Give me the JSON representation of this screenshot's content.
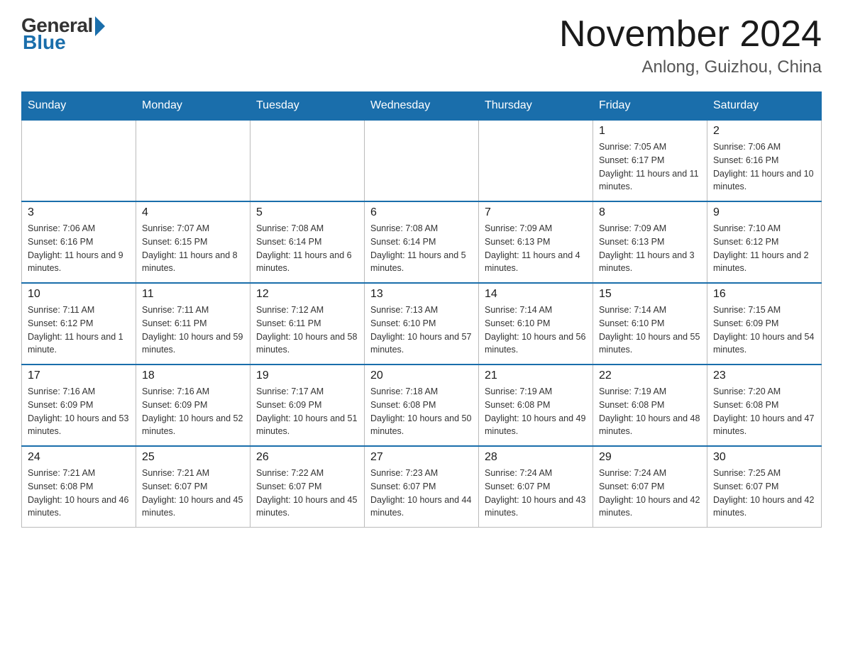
{
  "header": {
    "logo": {
      "general": "General",
      "blue": "Blue"
    },
    "title": "November 2024",
    "location": "Anlong, Guizhou, China"
  },
  "days_of_week": [
    "Sunday",
    "Monday",
    "Tuesday",
    "Wednesday",
    "Thursday",
    "Friday",
    "Saturday"
  ],
  "weeks": [
    {
      "days": [
        {
          "number": "",
          "info": ""
        },
        {
          "number": "",
          "info": ""
        },
        {
          "number": "",
          "info": ""
        },
        {
          "number": "",
          "info": ""
        },
        {
          "number": "",
          "info": ""
        },
        {
          "number": "1",
          "info": "Sunrise: 7:05 AM\nSunset: 6:17 PM\nDaylight: 11 hours and 11 minutes."
        },
        {
          "number": "2",
          "info": "Sunrise: 7:06 AM\nSunset: 6:16 PM\nDaylight: 11 hours and 10 minutes."
        }
      ]
    },
    {
      "days": [
        {
          "number": "3",
          "info": "Sunrise: 7:06 AM\nSunset: 6:16 PM\nDaylight: 11 hours and 9 minutes."
        },
        {
          "number": "4",
          "info": "Sunrise: 7:07 AM\nSunset: 6:15 PM\nDaylight: 11 hours and 8 minutes."
        },
        {
          "number": "5",
          "info": "Sunrise: 7:08 AM\nSunset: 6:14 PM\nDaylight: 11 hours and 6 minutes."
        },
        {
          "number": "6",
          "info": "Sunrise: 7:08 AM\nSunset: 6:14 PM\nDaylight: 11 hours and 5 minutes."
        },
        {
          "number": "7",
          "info": "Sunrise: 7:09 AM\nSunset: 6:13 PM\nDaylight: 11 hours and 4 minutes."
        },
        {
          "number": "8",
          "info": "Sunrise: 7:09 AM\nSunset: 6:13 PM\nDaylight: 11 hours and 3 minutes."
        },
        {
          "number": "9",
          "info": "Sunrise: 7:10 AM\nSunset: 6:12 PM\nDaylight: 11 hours and 2 minutes."
        }
      ]
    },
    {
      "days": [
        {
          "number": "10",
          "info": "Sunrise: 7:11 AM\nSunset: 6:12 PM\nDaylight: 11 hours and 1 minute."
        },
        {
          "number": "11",
          "info": "Sunrise: 7:11 AM\nSunset: 6:11 PM\nDaylight: 10 hours and 59 minutes."
        },
        {
          "number": "12",
          "info": "Sunrise: 7:12 AM\nSunset: 6:11 PM\nDaylight: 10 hours and 58 minutes."
        },
        {
          "number": "13",
          "info": "Sunrise: 7:13 AM\nSunset: 6:10 PM\nDaylight: 10 hours and 57 minutes."
        },
        {
          "number": "14",
          "info": "Sunrise: 7:14 AM\nSunset: 6:10 PM\nDaylight: 10 hours and 56 minutes."
        },
        {
          "number": "15",
          "info": "Sunrise: 7:14 AM\nSunset: 6:10 PM\nDaylight: 10 hours and 55 minutes."
        },
        {
          "number": "16",
          "info": "Sunrise: 7:15 AM\nSunset: 6:09 PM\nDaylight: 10 hours and 54 minutes."
        }
      ]
    },
    {
      "days": [
        {
          "number": "17",
          "info": "Sunrise: 7:16 AM\nSunset: 6:09 PM\nDaylight: 10 hours and 53 minutes."
        },
        {
          "number": "18",
          "info": "Sunrise: 7:16 AM\nSunset: 6:09 PM\nDaylight: 10 hours and 52 minutes."
        },
        {
          "number": "19",
          "info": "Sunrise: 7:17 AM\nSunset: 6:09 PM\nDaylight: 10 hours and 51 minutes."
        },
        {
          "number": "20",
          "info": "Sunrise: 7:18 AM\nSunset: 6:08 PM\nDaylight: 10 hours and 50 minutes."
        },
        {
          "number": "21",
          "info": "Sunrise: 7:19 AM\nSunset: 6:08 PM\nDaylight: 10 hours and 49 minutes."
        },
        {
          "number": "22",
          "info": "Sunrise: 7:19 AM\nSunset: 6:08 PM\nDaylight: 10 hours and 48 minutes."
        },
        {
          "number": "23",
          "info": "Sunrise: 7:20 AM\nSunset: 6:08 PM\nDaylight: 10 hours and 47 minutes."
        }
      ]
    },
    {
      "days": [
        {
          "number": "24",
          "info": "Sunrise: 7:21 AM\nSunset: 6:08 PM\nDaylight: 10 hours and 46 minutes."
        },
        {
          "number": "25",
          "info": "Sunrise: 7:21 AM\nSunset: 6:07 PM\nDaylight: 10 hours and 45 minutes."
        },
        {
          "number": "26",
          "info": "Sunrise: 7:22 AM\nSunset: 6:07 PM\nDaylight: 10 hours and 45 minutes."
        },
        {
          "number": "27",
          "info": "Sunrise: 7:23 AM\nSunset: 6:07 PM\nDaylight: 10 hours and 44 minutes."
        },
        {
          "number": "28",
          "info": "Sunrise: 7:24 AM\nSunset: 6:07 PM\nDaylight: 10 hours and 43 minutes."
        },
        {
          "number": "29",
          "info": "Sunrise: 7:24 AM\nSunset: 6:07 PM\nDaylight: 10 hours and 42 minutes."
        },
        {
          "number": "30",
          "info": "Sunrise: 7:25 AM\nSunset: 6:07 PM\nDaylight: 10 hours and 42 minutes."
        }
      ]
    }
  ]
}
